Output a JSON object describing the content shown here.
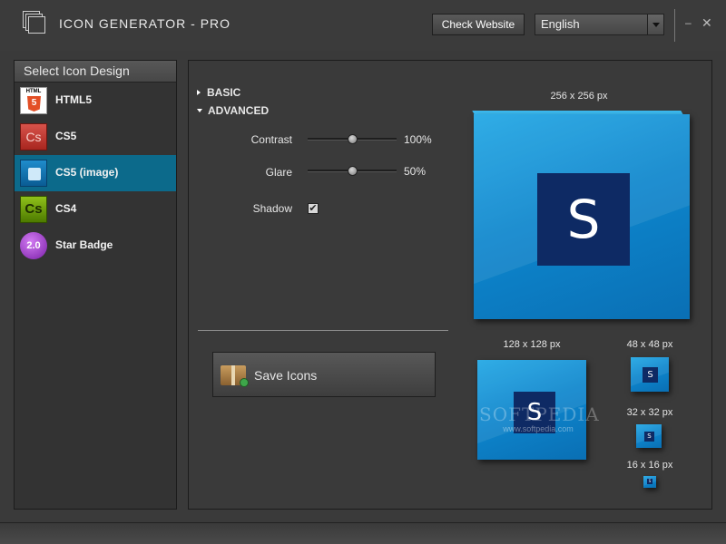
{
  "app": {
    "title": "ICON GENERATOR - PRO",
    "logo_icon": "stacked-windows-icon"
  },
  "header": {
    "check_website_label": "Check Website",
    "language_selected": "English",
    "minimize_glyph": "–",
    "close_glyph": "✕"
  },
  "sidebar": {
    "title": "Select Icon Design",
    "selected_index": 2,
    "items": [
      {
        "label": "HTML5",
        "icon": "html5-icon",
        "icon_text_top": "HTML",
        "icon_text": "5"
      },
      {
        "label": "CS5",
        "icon": "cs5-icon",
        "icon_text": "Cs"
      },
      {
        "label": "CS5 (image)",
        "icon": "puzzle-icon",
        "icon_text": ""
      },
      {
        "label": "CS4",
        "icon": "cs4-icon",
        "icon_text": "Cs"
      },
      {
        "label": "Star Badge",
        "icon": "star-badge-icon",
        "icon_text": "2.0"
      }
    ]
  },
  "settings": {
    "basic_label": "BASIC",
    "advanced_label": "ADVANCED",
    "contrast_label": "Contrast",
    "contrast_value": "100%",
    "contrast_level": 0.5,
    "glare_label": "Glare",
    "glare_value": "50%",
    "glare_level": 0.5,
    "shadow_label": "Shadow",
    "shadow_checked": true,
    "save_label": "Save Icons"
  },
  "previews": {
    "letter": "S",
    "size_256": "256 x 256 px",
    "size_128": "128 x 128 px",
    "size_48": "48 x 48 px",
    "size_32": "32 x 32 px",
    "size_16": "16 x 16 px"
  },
  "watermark": {
    "brand": "SOFTPEDIA",
    "url": "www.softpedia.com"
  },
  "colors": {
    "selection": "#0c6a8b",
    "icon_blue": "#0d86cd",
    "icon_plate": "#0e2a64"
  }
}
